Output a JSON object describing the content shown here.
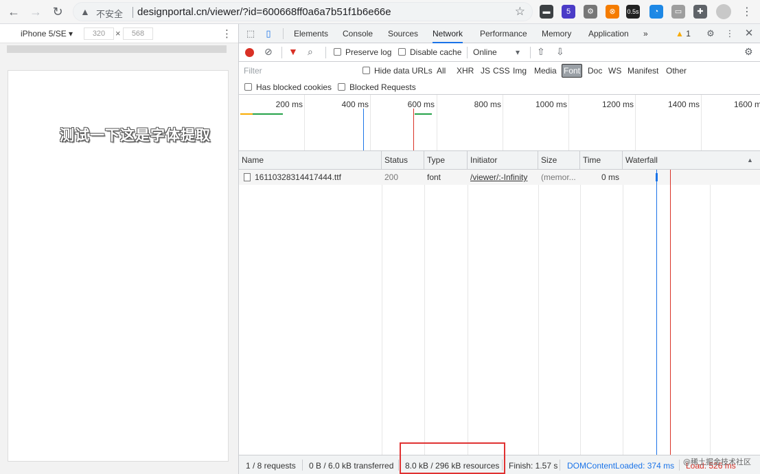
{
  "browser": {
    "security_label": "不安全",
    "url": "designportal.cn/viewer/?id=600668ff0a6a7b51f1b6e66e",
    "extensions": [
      {
        "name": "ext-a",
        "color": "#3c4043",
        "label": "▬"
      },
      {
        "name": "ext-b",
        "color": "#4b3cc7",
        "label": "5"
      },
      {
        "name": "ext-c",
        "color": "#777777",
        "label": "⚙"
      },
      {
        "name": "ext-d",
        "color": "#f57c00",
        "label": "⊗"
      },
      {
        "name": "ext-e",
        "color": "#222222",
        "label": "0.5s"
      },
      {
        "name": "ext-f",
        "color": "#1e88e5",
        "label": "◔"
      },
      {
        "name": "ext-g",
        "color": "#9e9e9e",
        "label": "▭"
      },
      {
        "name": "ext-h",
        "color": "#5f6368",
        "label": "✚"
      }
    ]
  },
  "device": {
    "model": "iPhone 5/SE",
    "width": "320",
    "height": "568",
    "content_text": "测试一下这是字体提取"
  },
  "devtools": {
    "tabs": [
      "Elements",
      "Console",
      "Sources",
      "Network",
      "Performance",
      "Memory",
      "Application"
    ],
    "active_tab": "Network",
    "more_tabs": "»",
    "warnings": "1",
    "toolbar": {
      "preserve_log": "Preserve log",
      "disable_cache": "Disable cache",
      "throttle": "Online"
    },
    "filter": {
      "placeholder": "Filter",
      "hide_data_urls": "Hide data URLs",
      "types": [
        "All",
        "XHR",
        "JS",
        "CSS",
        "Img",
        "Media",
        "Font",
        "Doc",
        "WS",
        "Manifest",
        "Other"
      ],
      "active_type": "Font",
      "has_blocked_cookies": "Has blocked cookies",
      "blocked_requests": "Blocked Requests"
    },
    "overview_labels": [
      "200 ms",
      "400 ms",
      "600 ms",
      "800 ms",
      "1000 ms",
      "1200 ms",
      "1400 ms",
      "1600 ms"
    ],
    "columns": [
      "Name",
      "Status",
      "Type",
      "Initiator",
      "Size",
      "Time",
      "Waterfall"
    ],
    "rows": [
      {
        "name": "16110328314417444.ttf",
        "status": "200",
        "type": "font",
        "initiator": "/viewer/:-Infinity",
        "size": "(memor...",
        "time": "0 ms"
      }
    ],
    "status": {
      "requests": "1 / 8 requests",
      "transferred": "0 B / 6.0 kB transferred",
      "resources": "8.0 kB / 296 kB resources",
      "finish": "Finish: 1.57 s",
      "dom_loaded": "DOMContentLoaded: 374 ms",
      "load": "Load: 526 ms"
    },
    "colors": {
      "accent": "#1a73e8",
      "dom_line": "#1a73e8",
      "load_line": "#d93025",
      "highlight": "#e03131"
    },
    "watermark": "@稀土掘金技术社区"
  }
}
